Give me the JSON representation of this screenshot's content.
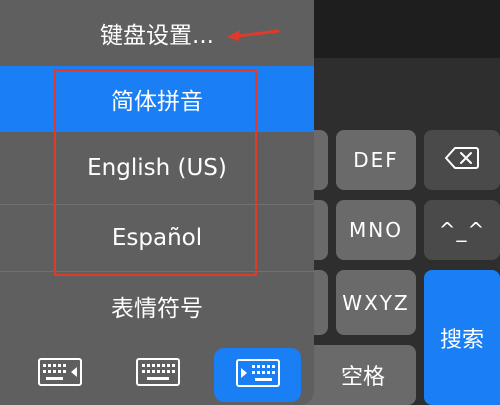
{
  "menu": {
    "title": "键盘设置...",
    "items": [
      {
        "label": "简体拼音",
        "selected": true
      },
      {
        "label": "English (US)",
        "selected": false
      },
      {
        "label": "Español",
        "selected": false
      },
      {
        "label": "表情符号",
        "selected": false
      }
    ],
    "bottom_icons": [
      "keyboard-left-icon",
      "keyboard-full-icon",
      "keyboard-right-icon"
    ]
  },
  "keys": {
    "def": "DEF",
    "mno": "MNO",
    "wxyz": "WXYZ",
    "search": "搜索",
    "space": "空格",
    "emoticon": "^_^",
    "delete_icon": "delete-icon"
  },
  "colors": {
    "accent": "#1a7ff5",
    "annotation": "#e03a2a"
  }
}
